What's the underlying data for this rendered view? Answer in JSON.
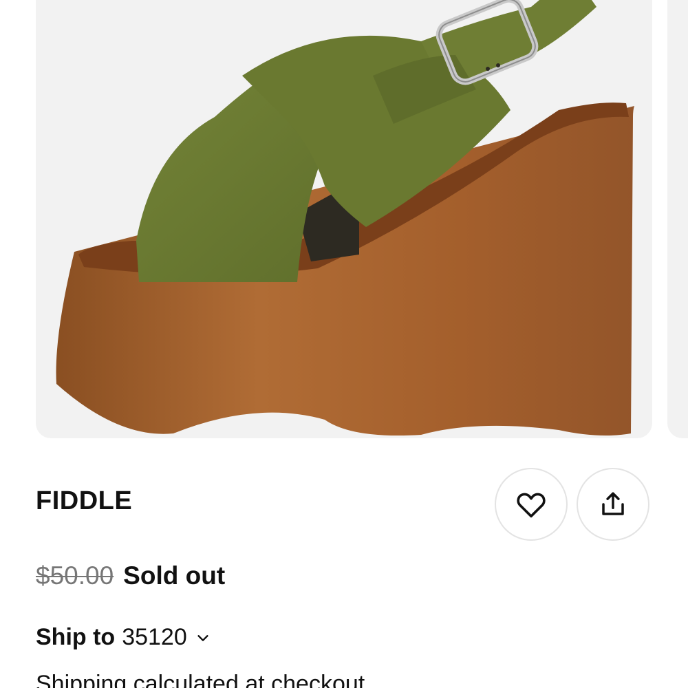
{
  "product": {
    "title": "FIDDLE",
    "compare_price": "$50.00",
    "availability": "Sold out",
    "image_alt": "Green suede platform wedge sandal with wooden sole"
  },
  "shipping": {
    "ship_label": "Ship to",
    "zip": "35120",
    "note": "Shipping calculated at checkout"
  },
  "actions": {
    "wishlist_icon": "heart-icon",
    "share_icon": "share-icon"
  },
  "colors": {
    "card_bg": "#f2f2f2",
    "text": "#111111",
    "muted": "#767676",
    "suede": "#6b7a32",
    "wood": "#a0622e"
  }
}
